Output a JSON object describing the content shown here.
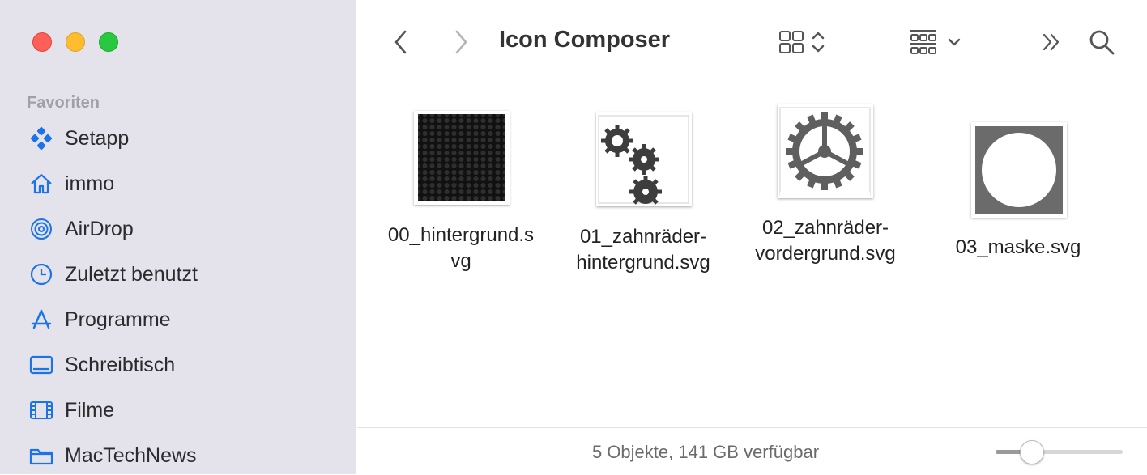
{
  "window": {
    "title": "Icon Composer"
  },
  "sidebar": {
    "section": "Favoriten",
    "items": [
      {
        "label": "Setapp",
        "icon": "setapp-icon"
      },
      {
        "label": "immo",
        "icon": "home-icon"
      },
      {
        "label": "AirDrop",
        "icon": "airdrop-icon"
      },
      {
        "label": "Zuletzt benutzt",
        "icon": "clock-icon"
      },
      {
        "label": "Programme",
        "icon": "apps-icon"
      },
      {
        "label": "Schreibtisch",
        "icon": "desktop-icon"
      },
      {
        "label": "Filme",
        "icon": "film-icon"
      },
      {
        "label": "MacTechNews",
        "icon": "folder-icon"
      }
    ]
  },
  "files": [
    {
      "line1": "00_hintergrund.s",
      "line2": "vg"
    },
    {
      "line1": "01_zahnräder-",
      "line2": "hintergrund.svg"
    },
    {
      "line1": "02_zahnräder-",
      "line2": "vordergrund.svg"
    },
    {
      "line1": "03_maske.svg",
      "line2": ""
    }
  ],
  "status": {
    "text": "5 Objekte, 141 GB verfügbar",
    "zoom_level": 0.28
  },
  "colors": {
    "accent": "#1a73e8",
    "sidebar_bg": "#e4e2ea"
  }
}
